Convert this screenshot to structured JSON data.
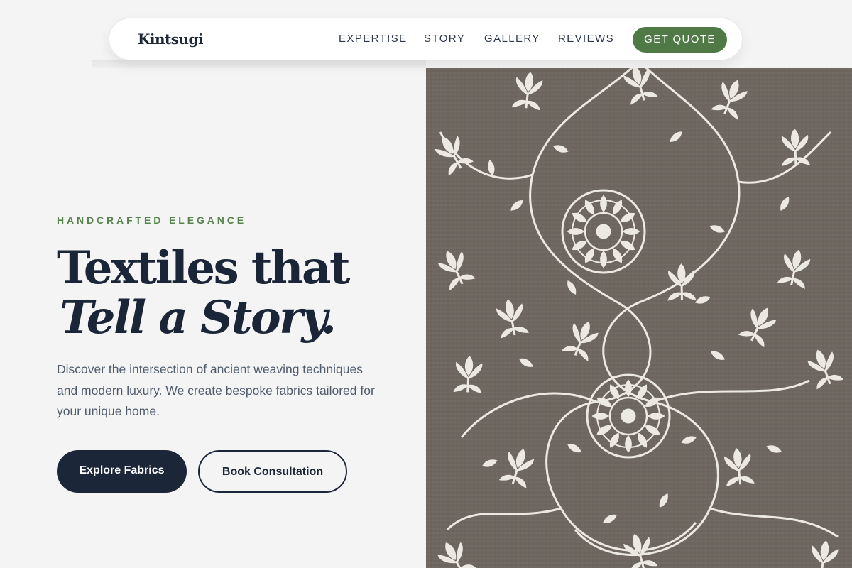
{
  "nav": {
    "logo": "Kintsugi",
    "links": [
      "EXPERTISE",
      "STORY",
      "GALLERY",
      "REVIEWS"
    ],
    "cta": "GET QUOTE"
  },
  "hero": {
    "eyebrow": "HANDCRAFTED ELEGANCE",
    "title_line1": "Textiles that",
    "title_line2": "Tell a Story.",
    "description": "Discover the intersection of ancient weaving techniques and modern luxury. We create bespoke fabrics tailored for your unique home.",
    "primary_button": "Explore Fabrics",
    "secondary_button": "Book Consultation"
  },
  "image": {
    "subject": "embroidered-floral-textile",
    "background_color": "#6f6861",
    "motif_color": "#ece9e2"
  },
  "colors": {
    "accent": "#4f7a45",
    "navy": "#1c2639",
    "page_background": "#f4f4f4"
  }
}
